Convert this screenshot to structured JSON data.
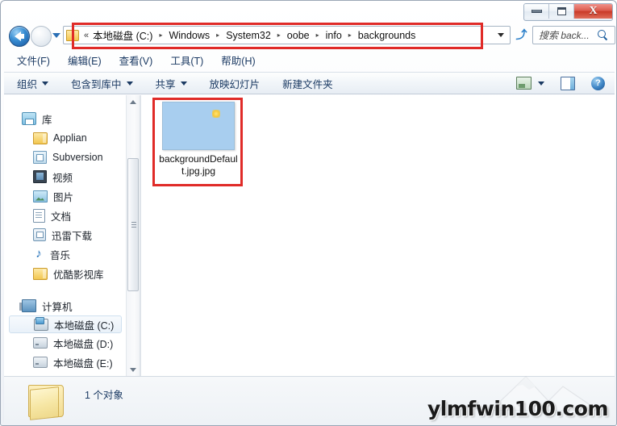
{
  "window": {
    "controls": {
      "minimize_label": "—",
      "maximize_label": "□",
      "close_label": "X"
    }
  },
  "address_bar": {
    "back_icon": "back-arrow-icon",
    "forward_icon": "forward-arrow-icon",
    "history_icon": "chevron-down-icon",
    "folder_icon": "folder-icon",
    "overflow_chevron": "«",
    "crumbs": [
      "本地磁盘 (C:)",
      "Windows",
      "System32",
      "oobe",
      "info",
      "backgrounds"
    ],
    "crumb_separator": "▸",
    "dropdown_icon": "chevron-down-icon",
    "refresh_icon": "↻",
    "refresh_glyph": "⤴"
  },
  "search": {
    "placeholder": "搜索 back...",
    "icon": "search-icon"
  },
  "menubar": {
    "items": [
      "文件(F)",
      "编辑(E)",
      "查看(V)",
      "工具(T)",
      "帮助(H)"
    ]
  },
  "toolbar": {
    "items": [
      {
        "label": "组织",
        "has_caret": true
      },
      {
        "label": "包含到库中",
        "has_caret": true
      },
      {
        "label": "共享",
        "has_caret": true
      },
      {
        "label": "放映幻灯片",
        "has_caret": false
      },
      {
        "label": "新建文件夹",
        "has_caret": false
      }
    ],
    "view_icon": "change-view-icon",
    "view_caret_icon": "chevron-down-icon",
    "preview_pane_icon": "preview-pane-icon",
    "help_icon": "help-icon",
    "help_label": "?"
  },
  "navigation_pane": {
    "groups": [
      {
        "root": {
          "label": "库",
          "icon": "library-icon"
        },
        "children": [
          {
            "label": "Applian",
            "icon": "folder-icon"
          },
          {
            "label": "Subversion",
            "icon": "subversion-icon"
          },
          {
            "label": "视频",
            "icon": "videos-icon"
          },
          {
            "label": "图片",
            "icon": "pictures-icon"
          },
          {
            "label": "文档",
            "icon": "documents-icon"
          },
          {
            "label": "迅雷下载",
            "icon": "download-icon"
          },
          {
            "label": "音乐",
            "icon": "music-icon",
            "glyph": "♪"
          },
          {
            "label": "优酷影视库",
            "icon": "folder-icon"
          }
        ]
      },
      {
        "root": {
          "label": "计算机",
          "icon": "computer-icon"
        },
        "children": [
          {
            "label": "本地磁盘 (C:)",
            "icon": "system-drive-icon",
            "selected": true
          },
          {
            "label": "本地磁盘 (D:)",
            "icon": "drive-icon",
            "selected": false
          },
          {
            "label": "本地磁盘 (E:)",
            "icon": "drive-icon",
            "selected": false
          }
        ]
      }
    ],
    "scrollbar": {
      "up_icon": "scroll-up-icon",
      "down_icon": "scroll-down-icon"
    }
  },
  "content_pane": {
    "files": [
      {
        "name": "backgroundDefault.jpg.jpg",
        "thumbnail": {
          "sky_color": "#a8ceef",
          "sun_color": "#f5c83a"
        }
      }
    ]
  },
  "status_bar": {
    "folder_icon": "folder-icon",
    "text": "1 个对象"
  },
  "annotations": {
    "color": "#e02b28",
    "boxes": [
      {
        "name": "address-bar-highlight"
      },
      {
        "name": "file-item-highlight"
      }
    ]
  },
  "watermark": {
    "text": "ylmfwin100.com"
  }
}
